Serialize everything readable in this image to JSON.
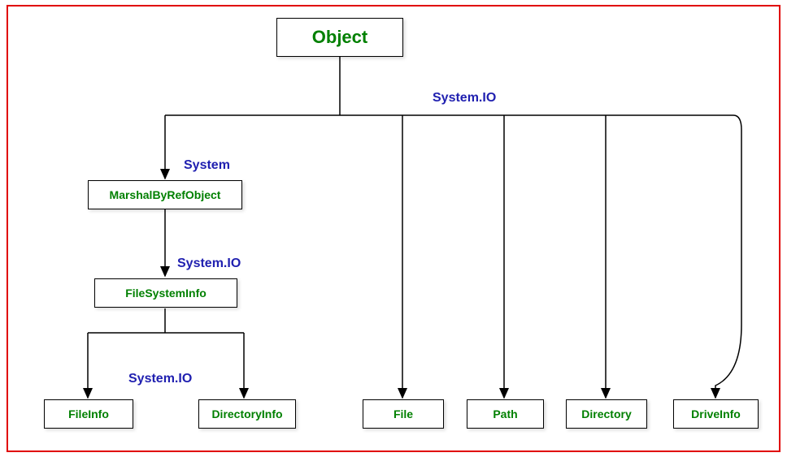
{
  "nodes": {
    "object": "Object",
    "marshal": "MarshalByRefObject",
    "fsi": "FileSystemInfo",
    "fileinfo": "FileInfo",
    "directoryinfo": "DirectoryInfo",
    "file": "File",
    "path": "Path",
    "directory": "Directory",
    "driveinfo": "DriveInfo"
  },
  "namespaces": {
    "sysio_top": "System.IO",
    "system": "System",
    "sysio_mid": "System.IO",
    "sysio_bottom": "System.IO"
  }
}
